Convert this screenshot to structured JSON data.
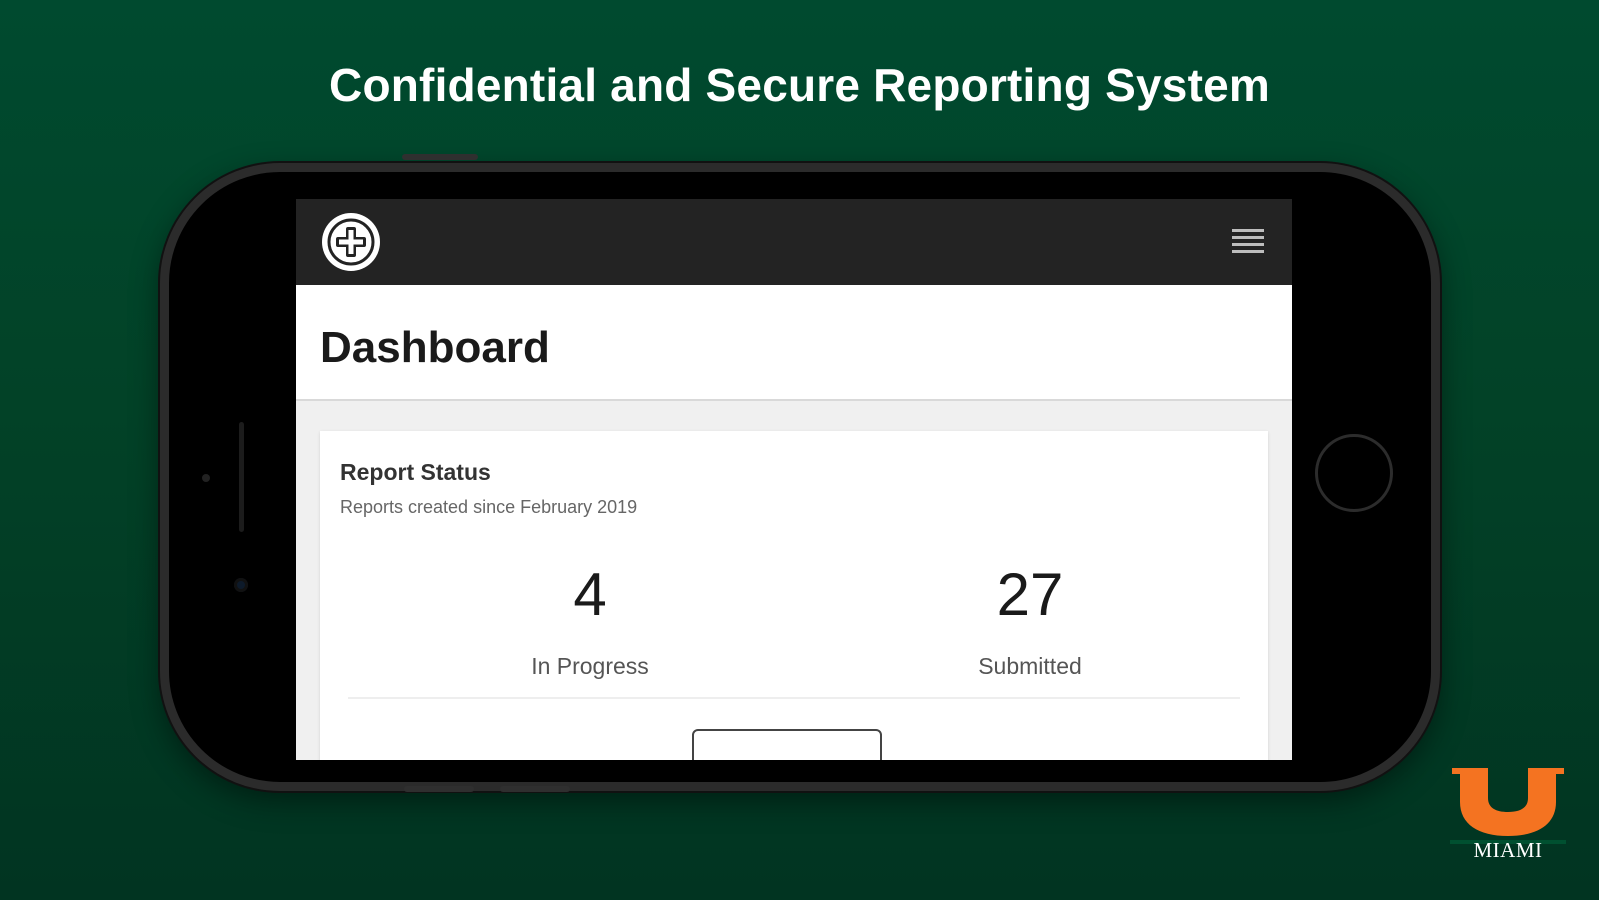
{
  "headline": "Confidential and Secure Reporting System",
  "app": {
    "logo_icon": "plus-badge-icon",
    "menu_icon": "hamburger-menu-icon",
    "page_title": "Dashboard",
    "report_status": {
      "title": "Report Status",
      "subtitle": "Reports created since February 2019",
      "in_progress": {
        "value": "4",
        "label": "In Progress"
      },
      "submitted": {
        "value": "27",
        "label": "Submitted"
      }
    }
  },
  "branding": {
    "name": "MIAMI",
    "colors": {
      "background_green": "#004a2f",
      "logo_orange": "#f47321",
      "logo_green": "#005030"
    }
  }
}
